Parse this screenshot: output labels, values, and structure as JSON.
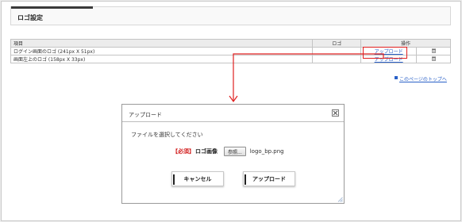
{
  "page": {
    "title": "ロゴ設定"
  },
  "table": {
    "headers": {
      "item": "項目",
      "logo": "ロゴ",
      "operation": "操作"
    },
    "rows": [
      {
        "item": "ログイン画面のロゴ (241px X 51px)",
        "action": "アップロード"
      },
      {
        "item": "画面左上のロゴ (158px X 33px)",
        "action": "アップロード"
      }
    ]
  },
  "pagetop_link": "このページのトップへ",
  "dialog": {
    "title": "アップロード",
    "message": "ファイルを選択してください",
    "required_tag": "【必須】",
    "field_label": "ロゴ画像",
    "browse_label": "参照...",
    "file_name": "logo_bp.png",
    "cancel_label": "キャンセル",
    "upload_label": "アップロード"
  },
  "colors": {
    "highlight": "#e02020",
    "link": "#2a61c8",
    "required": "#d11a1a"
  },
  "icons": {
    "delete": "trash-icon",
    "close": "close-icon",
    "arrow": "arrow-down-icon"
  }
}
